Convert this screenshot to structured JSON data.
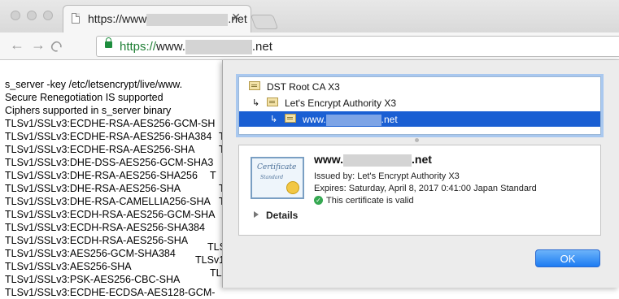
{
  "browser": {
    "tab": {
      "title_prefix": "https://www",
      "title_suffix": ".net",
      "close": "✕"
    },
    "nav": {
      "back": "←",
      "forward": "→",
      "reload": "C"
    },
    "address": {
      "scheme": "https://",
      "host_prefix": "www.",
      "host_suffix": ".net"
    }
  },
  "page": {
    "lines": [
      "s_server -key /etc/letsencrypt/live/www.",
      "Secure Renegotiation IS supported",
      "Ciphers supported in s_server binary",
      "TLSv1/SSLv3:ECDHE-RSA-AES256-GCM-SH",
      "TLSv1/SSLv3:ECDHE-RSA-AES256-SHA384",
      "TLSv1/SSLv3:ECDHE-RSA-AES256-SHA",
      "TLSv1/SSLv3:DHE-DSS-AES256-GCM-SHA3",
      "TLSv1/SSLv3:DHE-RSA-AES256-SHA256",
      "TLSv1/SSLv3:DHE-RSA-AES256-SHA",
      "TLSv1/SSLv3:DHE-RSA-CAMELLIA256-SHA",
      "TLSv1/SSLv3:ECDH-RSA-AES256-GCM-SHA",
      "TLSv1/SSLv3:ECDH-RSA-AES256-SHA384",
      "TLSv1/SSLv3:ECDH-RSA-AES256-SHA",
      "TLSv1/SSLv3:AES256-GCM-SHA384",
      "TLSv1/SSLv3:AES256-SHA",
      "TLSv1/SSLv3:PSK-AES256-CBC-SHA",
      "TLSv1/SSLv3:ECDHE-ECDSA-AES128-GCM-"
    ],
    "col2": [
      "T",
      "T",
      "T",
      "T",
      "T",
      "TLS",
      "TLSv1/",
      "TL"
    ]
  },
  "certificate": {
    "chain": [
      {
        "label": "DST Root CA X3"
      },
      {
        "label": "Let's Encrypt Authority X3"
      },
      {
        "label_prefix": "www.",
        "label_suffix": ".net"
      }
    ],
    "name_prefix": "www.",
    "name_suffix": ".net",
    "issued_by": "Issued by: Let's Encrypt Authority X3",
    "expires": "Expires: Saturday, April 8, 2017 0:41:00 Japan Standard",
    "status": "This certificate is valid",
    "details_label": "Details",
    "icon_title": "Certificate",
    "icon_subtitle": "Standard"
  },
  "dialog": {
    "ok_label": "OK"
  },
  "colors": {
    "selection": "#1a5fd3",
    "ok_button": "#1d7cf2",
    "secure_green": "#1e8e3e"
  }
}
